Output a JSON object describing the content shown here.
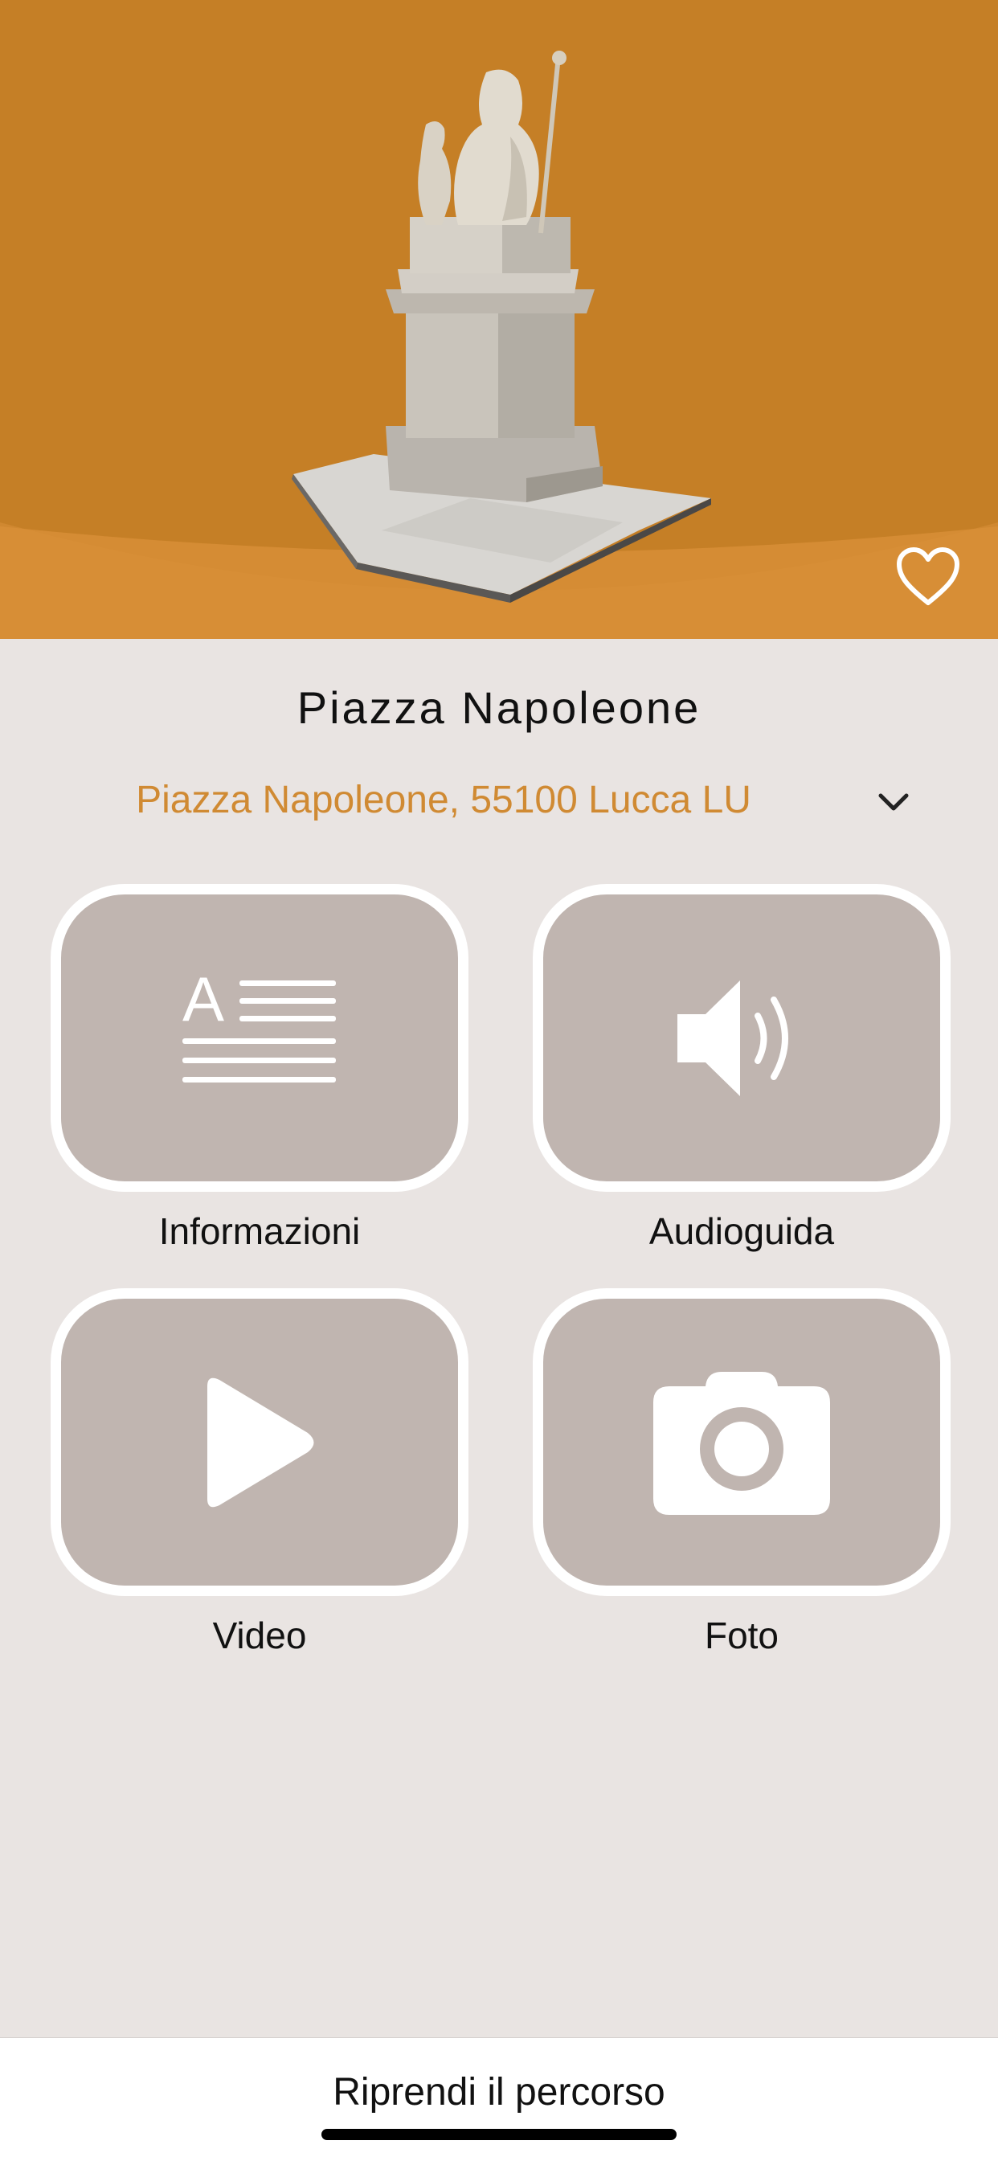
{
  "hero": {
    "image": "statue-3d-model",
    "background_color": "#c57f26",
    "favorite_icon": "heart-outline-icon"
  },
  "place": {
    "title": "Piazza Napoleone",
    "address": "Piazza Napoleone, 55100 Lucca LU",
    "address_color": "#d08a33",
    "expand_icon": "chevron-down-icon"
  },
  "menu": {
    "items": [
      {
        "label": "Informazioni",
        "icon": "text-document-icon"
      },
      {
        "label": "Audioguida",
        "icon": "speaker-icon"
      },
      {
        "label": "Video",
        "icon": "play-icon"
      },
      {
        "label": "Foto",
        "icon": "camera-icon"
      }
    ],
    "tile_color": "#c0b5b0"
  },
  "footer": {
    "button_label": "Riprendi il percorso"
  }
}
